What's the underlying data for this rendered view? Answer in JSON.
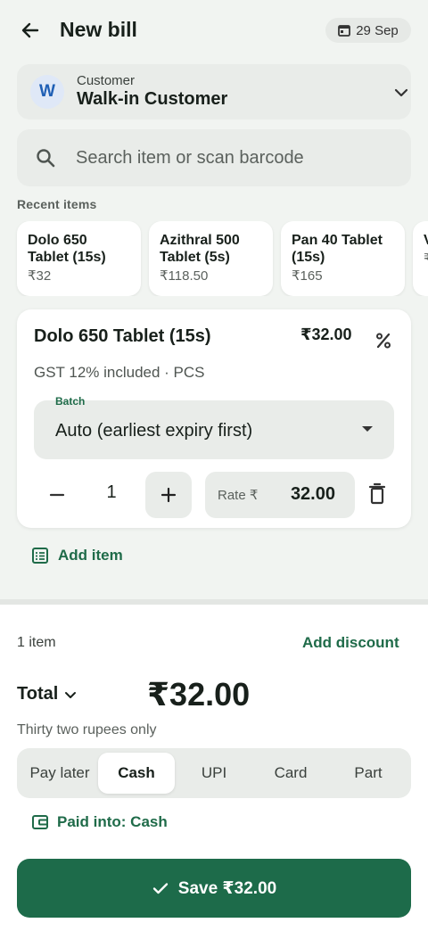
{
  "colors": {
    "accent": "#1d6b4a",
    "surface": "#f1f4f1",
    "field": "#e9ece9",
    "avatar_bg": "#dfe8f7",
    "avatar_text": "#1f5fb5"
  },
  "header": {
    "title": "New bill",
    "date": "29 Sep",
    "back_icon": "arrow-left-icon",
    "date_icon": "calendar-icon"
  },
  "customer": {
    "avatar_letter": "W",
    "label": "Customer",
    "name": "Walk-in Customer",
    "chevron_icon": "chevron-down-icon"
  },
  "search": {
    "placeholder": "Search item or scan barcode",
    "value": "",
    "icon": "search-icon"
  },
  "recent": {
    "label": "Recent items",
    "items": [
      {
        "name": "Dolo 650 Tablet (15s)",
        "price": "₹32"
      },
      {
        "name": "Azithral 500 Tablet (5s)",
        "price": "₹118.50"
      },
      {
        "name": "Pan 40 Tablet (15s)",
        "price": "₹165"
      },
      {
        "name": "V g",
        "price": "₹"
      }
    ]
  },
  "line_item": {
    "name": "Dolo 650 Tablet (15s)",
    "price": "₹32.00",
    "meta": "GST 12% included · PCS",
    "batch_label": "Batch",
    "batch_value": "Auto (earliest expiry first)",
    "quantity": "1",
    "rate_label": "Rate ₹",
    "rate_value": "32.00",
    "icons": {
      "discount": "percent-icon",
      "minus": "minus-icon",
      "plus": "plus-icon",
      "delete": "trash-icon",
      "caret": "caret-down-icon"
    }
  },
  "add_item": {
    "label": "Add item",
    "icon": "list-add-icon"
  },
  "summary": {
    "count": "1 item",
    "add_discount": "Add discount",
    "total_label": "Total",
    "total_amount": "₹32.00",
    "amount_words": "Thirty two rupees only"
  },
  "payment": {
    "tabs": [
      "Pay later",
      "Cash",
      "UPI",
      "Card",
      "Part"
    ],
    "selected": "Cash",
    "paid_into": "Paid into: Cash",
    "paid_into_icon": "wallet-icon"
  },
  "save_button": {
    "label": "Save ₹32.00",
    "icon": "check-icon"
  }
}
